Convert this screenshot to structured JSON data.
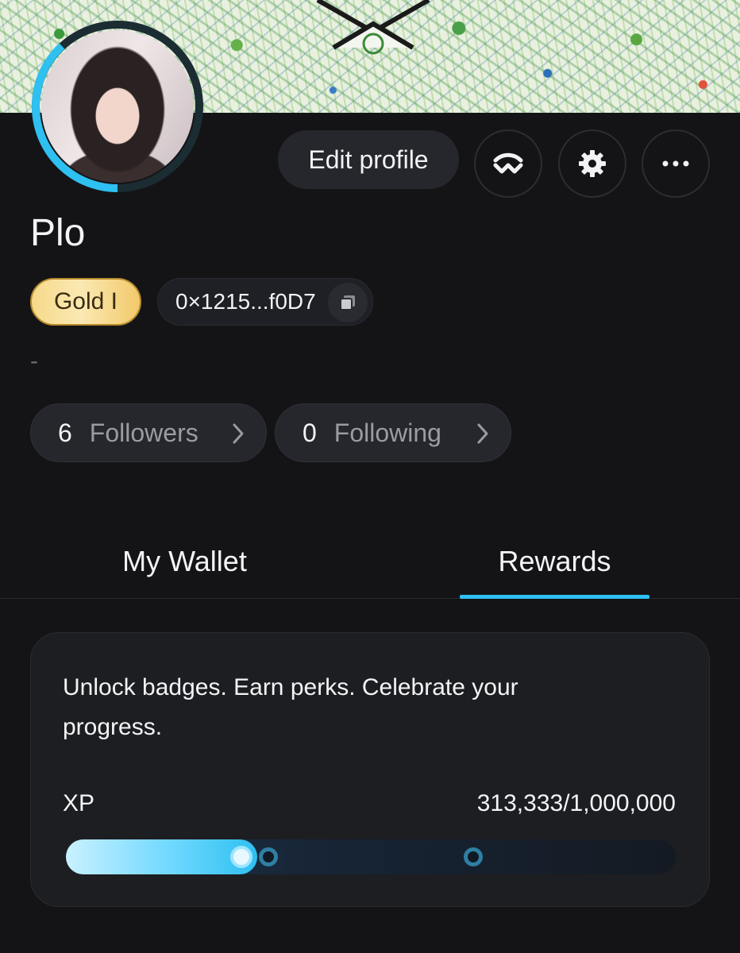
{
  "profile": {
    "username": "Plo",
    "tier": "Gold I",
    "wallet_address": "0×1215...f0D7",
    "bio": "-",
    "followers_count": "6",
    "followers_label": "Followers",
    "following_count": "0",
    "following_label": "Following"
  },
  "actions": {
    "edit_profile_label": "Edit profile"
  },
  "icons": {
    "connect": "walletconnect-icon",
    "settings": "gear-icon",
    "more": "more-horizontal-icon",
    "copy": "copy-icon",
    "chevron": "chevron-right-icon"
  },
  "tabs": [
    {
      "label": "My Wallet",
      "active": false
    },
    {
      "label": "Rewards",
      "active": true
    }
  ],
  "rewards": {
    "description": "Unlock badges. Earn perks. Celebrate your progress.",
    "xp_label": "XP",
    "xp_value": "313,333/1,000,000",
    "xp_current": 313333,
    "xp_max": 1000000,
    "milestones": [
      0.332,
      0.668
    ]
  },
  "colors": {
    "accent": "#2ec0f0",
    "background": "#141416",
    "card": "#1d1e22",
    "gold": "#f6d98a"
  }
}
